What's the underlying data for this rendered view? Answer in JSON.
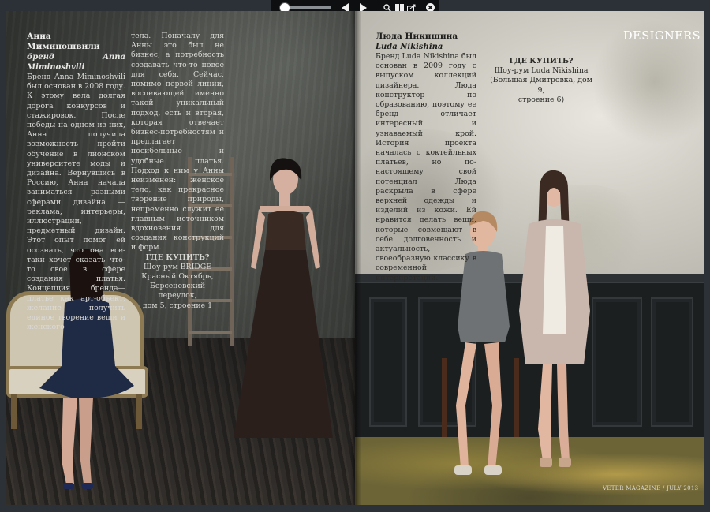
{
  "toolbar": {
    "zoom_slider": "zoom",
    "icons": [
      "prev-page-icon",
      "next-page-icon",
      "search-icon",
      "thumbnails-icon",
      "share-icon",
      "close-icon"
    ]
  },
  "left_page": {
    "name": "Анна Миминошвили",
    "brand": "бренд Anna Miminoshvili",
    "col1": "Бренд Anna Miminoshvili был основан в 2008 году. К этому вела долгая дорога конкурсов и стажировок. После победы на одном из них, Анна получила возможность пройти обучение в лионском университете моды и дизайна. Вернувшись в Россию, Анна начала заниматься разными сферами дизайна — реклама, интерьеры, иллюстрации, предметный дизайн. Этот опыт помог ей осознать, что она все-таки хочет сказать что-то свое в сфере создания платья. Концепция бренда— платье как арт-объект, желание получить единое творение вещи и женского",
    "col2": "тела. Поначалу для Анны это был не бизнес, а потребность создавать что-то новое для себя. Сейчас, помимо первой линии, воспевающей именно такой уникальный подход, есть и вторая, которая отвечает бизнес-потребностям и предлагает носибельные и удобные платья. Подход к ним у Анны неизменен: женское тело, как прекрасное творение природы, непременно служит ее главным источником вдохновения для создания конструкций и форм.",
    "where_title": "ГДЕ КУПИТЬ?",
    "where_lines": [
      "Шоу-рум BRIDGE",
      "Красный Октябрь,",
      "Берсеневский переулок,",
      "дом 5, строение 1"
    ]
  },
  "right_page": {
    "section": "DESIGNERS",
    "name": "Люда Никишина",
    "brand": "Luda Nikishina",
    "col1": "Бренд Luda Nikishina был основан в 2009 году с выпуском коллекций дизайнера. Люда конструктор по образованию, поэтому ее бренд отличает интересный и узнаваемый крой. История проекта началась с коктейльных платьев, но по-настоящему свой потенциал Люда раскрыла в сфере верхней одежды и изделий из кожи. Ей нравится делать вещи, которые совмещают в себе долговечность и актуальность, — своеобразную классику в современной интерпретации.",
    "where_title": "ГДЕ КУПИТЬ?",
    "where_lines": [
      "Шоу-рум Luda Nikishina",
      "(Большая Дмитровка, дом 9,",
      "строение 6)"
    ],
    "footer": "VETER MAGAZINE / JULY 2013"
  }
}
